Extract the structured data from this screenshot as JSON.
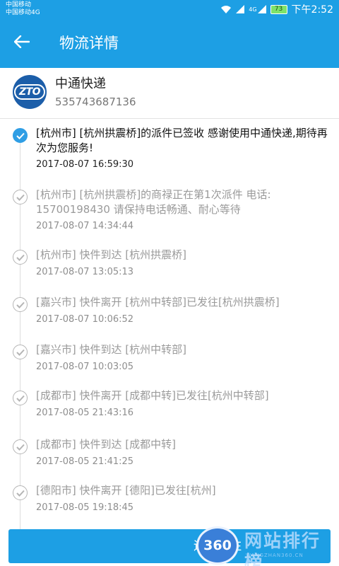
{
  "status_bar": {
    "carrier_1": "中国移动",
    "carrier_2": "中国移动4G",
    "network": "4G",
    "battery": "73",
    "time": "下午2:52",
    "icons": [
      "wifi-icon",
      "signal-icon",
      "signal-4g-icon",
      "battery-icon"
    ]
  },
  "header": {
    "title": "物流详情",
    "back_icon": "arrow-left-icon",
    "background": "#1d9fe4"
  },
  "courier": {
    "logo_text": "ZTO",
    "name": "中通快递",
    "tracking_number": "535743687136",
    "logo_color": "#1c5ea9"
  },
  "timeline": [
    {
      "text": "[杭州市] [杭州拱震桥]的派件已签收 感谢使用中通快递,期待再次为您服务!",
      "time": "2017-08-07 16:59:30",
      "active": true
    },
    {
      "text": "[杭州市] [杭州拱震桥]的商禄正在第1次派件 电话: 15700198430 请保持电话畅通、耐心等待",
      "time": "2017-08-07 14:34:44",
      "active": false
    },
    {
      "text": "[杭州市] 快件到达 [杭州拱震桥]",
      "time": "2017-08-07 13:05:13",
      "active": false
    },
    {
      "text": "[嘉兴市] 快件离开 [杭州中转部]已发往[杭州拱震桥]",
      "time": "2017-08-07 10:06:52",
      "active": false
    },
    {
      "text": "[嘉兴市] 快件到达 [杭州中转部]",
      "time": "2017-08-07 10:03:05",
      "active": false
    },
    {
      "text": "[成都市] 快件离开 [成都中转]已发往[杭州中转部]",
      "time": "2017-08-05 21:43:16",
      "active": false
    },
    {
      "text": "[成都市] 快件到达 [成都中转]",
      "time": "2017-08-05 21:41:25",
      "active": false
    },
    {
      "text": "[德阳市] 快件离开 [德阳]已发往[杭州]",
      "time": "2017-08-05 19:18:45",
      "active": false
    }
  ],
  "bottom_button": {
    "label": "运单备注",
    "watermark_badge": "360",
    "watermark_text": "网站排行榜",
    "watermark_sub": "WANGZHAN360.CN"
  },
  "colors": {
    "accent": "#1d9fe4",
    "active_dot": "#2f9ee5",
    "inactive_text": "#9a9a9a"
  }
}
